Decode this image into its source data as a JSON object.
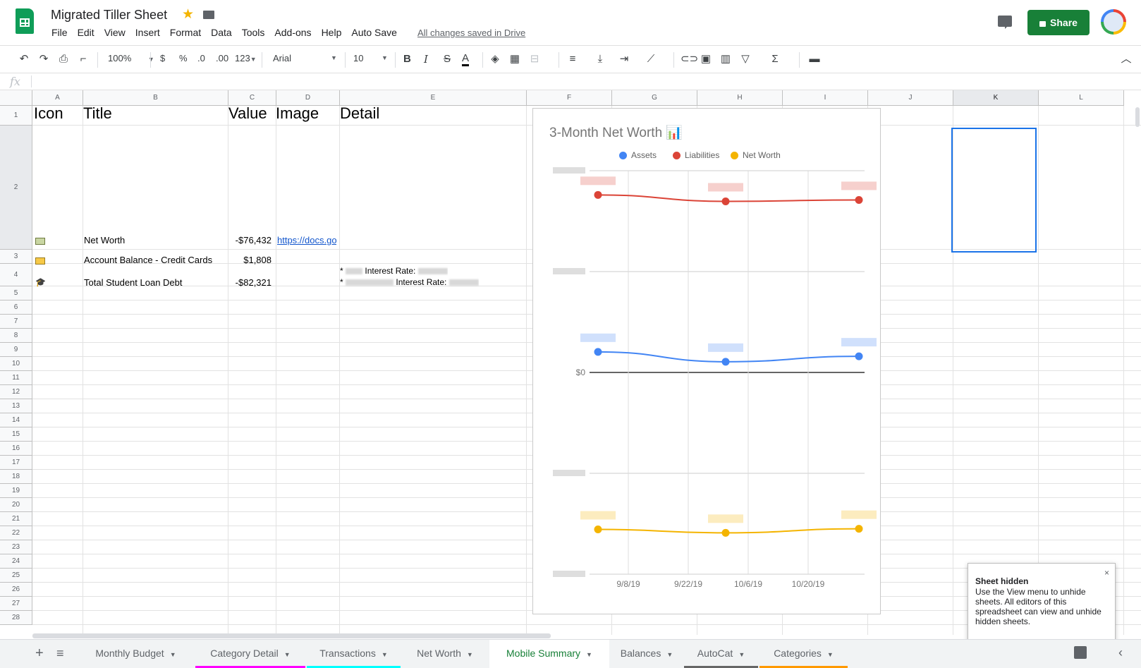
{
  "app": {
    "doc_title": "Migrated Tiller Sheet",
    "saved_msg": "All changes saved in Drive",
    "share_label": "Share",
    "menus": [
      "File",
      "Edit",
      "View",
      "Insert",
      "Format",
      "Data",
      "Tools",
      "Add-ons",
      "Help",
      "Auto Save"
    ]
  },
  "toolbar": {
    "zoom": "100%",
    "currency": "$",
    "percent": "%",
    "dec_less": ".0",
    "dec_more": ".00",
    "format_more": "123",
    "font": "Arial",
    "font_size": "10",
    "bold": "B",
    "italic": "I",
    "strike": "S",
    "text_color": "A"
  },
  "formula": {
    "fx": "fx"
  },
  "grid": {
    "columns": [
      "A",
      "B",
      "C",
      "D",
      "E",
      "F",
      "G",
      "H",
      "I",
      "J",
      "K",
      "L"
    ],
    "rows": [
      "1",
      "2",
      "3",
      "4",
      "5",
      "6",
      "7",
      "8",
      "9",
      "10",
      "11",
      "12",
      "13",
      "14",
      "15",
      "16",
      "17",
      "18",
      "19",
      "20",
      "21",
      "22",
      "23",
      "24",
      "25",
      "26",
      "27",
      "28"
    ],
    "header": {
      "icon": "Icon",
      "title": "Title",
      "value": "Value",
      "image": "Image",
      "detail": "Detail"
    },
    "r2": {
      "title": "Net Worth",
      "value": "-$76,432",
      "image": "https://docs.goo"
    },
    "r3": {
      "title": "Account Balance - Credit Cards",
      "value": "$1,808"
    },
    "r4": {
      "title": "Total Student Loan Debt",
      "value": "-$82,321",
      "detail1_prefix": "*",
      "detail1_label": "Interest Rate:",
      "detail2_prefix": "*",
      "detail2_label": "Interest Rate:"
    }
  },
  "chart_data": {
    "type": "line",
    "title": "3-Month Net Worth 📊",
    "x": [
      "9/8/19",
      "9/22/19",
      "10/6/19",
      "10/20/19"
    ],
    "x_points": [
      "9/1/19",
      "10/3/19",
      "11/5/19"
    ],
    "yticks_visible": [
      "$0"
    ],
    "series": [
      {
        "name": "Assets",
        "color": "#4285f4",
        "values": [
          10200,
          5300,
          8000
        ]
      },
      {
        "name": "Liabilities",
        "color": "#db4437",
        "values": [
          88000,
          84800,
          85500
        ]
      },
      {
        "name": "Net Worth",
        "color": "#f4b400",
        "values": [
          -77800,
          -79500,
          -77500
        ]
      }
    ],
    "ylim": [
      -100000,
      100000
    ],
    "legend": "top",
    "grid": true
  },
  "toast": {
    "title": "Sheet hidden",
    "body": "Use the View menu to unhide sheets. All editors of this spreadsheet can view and unhide hidden sheets.",
    "close": "×"
  },
  "tabs": [
    {
      "label": "Monthly Budget",
      "underline": ""
    },
    {
      "label": "Category Detail",
      "underline": "#ff00ff"
    },
    {
      "label": "Transactions",
      "underline": "#00ffff"
    },
    {
      "label": "Net Worth",
      "underline": ""
    },
    {
      "label": "Mobile Summary",
      "underline": "",
      "active": true
    },
    {
      "label": "Balances",
      "underline": ""
    },
    {
      "label": "AutoCat",
      "underline": "#666666"
    },
    {
      "label": "Categories",
      "underline": "#ff9900"
    }
  ]
}
